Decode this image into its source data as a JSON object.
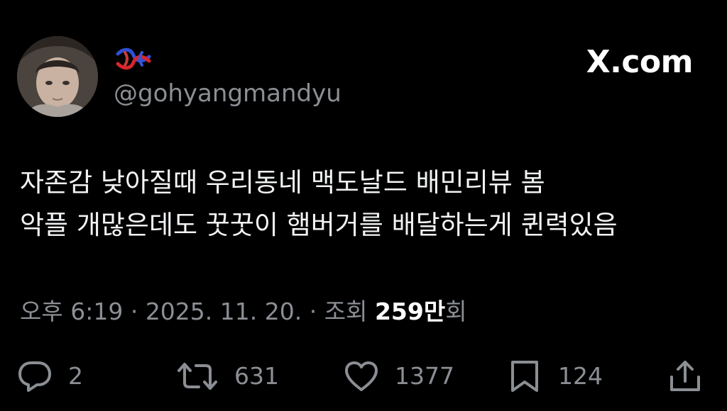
{
  "brand": {
    "label": "X.com"
  },
  "author": {
    "handle": "@gohyangmandyu",
    "display_name_icon": "knot-emoji-icon",
    "avatar_icon": "profile-photo"
  },
  "tweet": {
    "lines": [
      "자존감 낮아질때 우리동네 맥도날드 배민리뷰 봄",
      "악플 개많은데도 꿋꿋이 햄버거를 배달하는게 퀸력있음"
    ]
  },
  "meta": {
    "time": "오후 6:19",
    "sep1": " · ",
    "date": "2025. 11. 20.",
    "sep2": " · ",
    "views_label": "조회 ",
    "views_count": "259만",
    "views_suffix": "회"
  },
  "actions": {
    "reply": {
      "icon": "reply-icon",
      "count": "2"
    },
    "repost": {
      "icon": "repost-icon",
      "count": "631"
    },
    "like": {
      "icon": "heart-icon",
      "count": "1377"
    },
    "bookmark": {
      "icon": "bookmark-icon",
      "count": "124"
    },
    "share": {
      "icon": "share-icon"
    }
  },
  "colors": {
    "background": "#000000",
    "text": "#f2f3f4",
    "muted": "#8b8f94",
    "icon": "#8b8f94"
  }
}
